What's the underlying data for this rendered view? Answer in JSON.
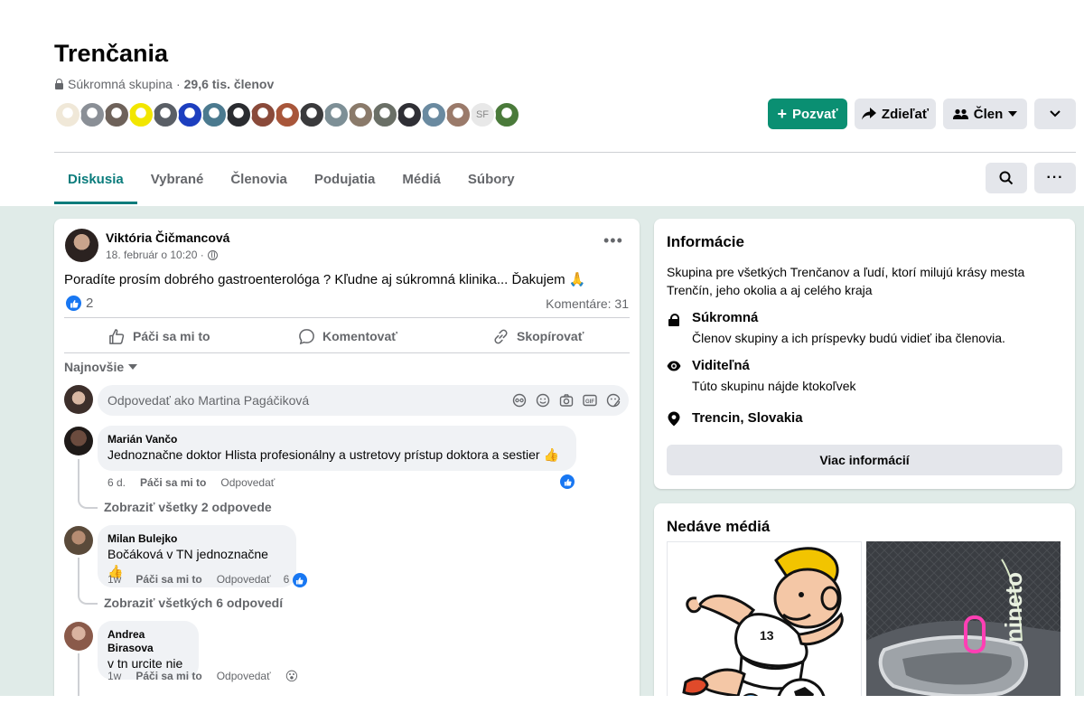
{
  "header": {
    "title": "Trenčania",
    "privacy": "Súkromná skupina",
    "separator": " · ",
    "members": "29,6 tis. členov",
    "avatar_colors": [
      "#f0e8d8",
      "#8a8f96",
      "#6e625a",
      "#f2e600",
      "#5a5f66",
      "#1d3fbf",
      "#4b7a8f",
      "#2a2c30",
      "#8a4a3a",
      "#a8563a",
      "#3a3a3c",
      "#7d8f96",
      "#8a7a6a",
      "#6a6f66",
      "#2f2f35",
      "#6a8aa0",
      "#9a7a6a",
      "#e8e8e8",
      "#4a7a3a"
    ],
    "avatar_label_gf": "SF",
    "buttons": {
      "invite": "Pozvať",
      "share": "Zdieľať",
      "member": "Člen"
    }
  },
  "tabs": [
    {
      "label": "Diskusia",
      "active": true
    },
    {
      "label": "Vybrané",
      "active": false
    },
    {
      "label": "Členovia",
      "active": false
    },
    {
      "label": "Podujatia",
      "active": false
    },
    {
      "label": "Médiá",
      "active": false
    },
    {
      "label": "Súbory",
      "active": false
    }
  ],
  "post": {
    "author": "Viktória Čičmancová",
    "time": "18. február o 10:20 ·",
    "text": "Poradíte prosím dobrého gastroenterológa ? Kľudne aj súkromná klinika... Ďakujem 🙏",
    "reactions": "2",
    "comments": "Komentáre: 31",
    "actions": {
      "like": "Páči sa mi to",
      "comment": "Komentovať",
      "copy": "Skopírovať"
    },
    "sort": "Najnovšie",
    "reply_placeholder": "Odpovedať ako Martina Pagáčiková"
  },
  "comments": [
    {
      "name": "Marián Vančo",
      "text": "Jednoznačne doktor Hlista profesionálny a ustretovy prístup doktora a sestier 👍",
      "time": "6 d.",
      "like": "Páči sa mi to",
      "reply": "Odpovedať",
      "view_replies": "Zobraziť všetky 2 odpovede"
    },
    {
      "name": "Milan Bulejko",
      "text": "Bočáková v TN jednoznačne 👍",
      "time": "1w",
      "like": "Páči sa mi to",
      "reply": "Odpovedať",
      "reaction_count": "6",
      "view_replies": "Zobraziť všetkých 6 odpovedí"
    },
    {
      "name": "Andrea Birasova",
      "text": "v tn urcite nie",
      "time": "1w",
      "like": "Páči sa mi to",
      "reply": "Odpovedať",
      "reaction_emoji": "😮"
    }
  ],
  "info": {
    "title": "Informácie",
    "description": "Skupina pre všetkých Trenčanov a ľudí, ktorí milujú krásy mesta Trenčín, jeho okolia a aj celého kraja",
    "private_title": "Súkromná",
    "private_desc": "Členov skupiny a ich príspevky budú vidieť iba členovia.",
    "visible_title": "Viditeľná",
    "visible_desc": "Túto skupinu nájde ktokoľvek",
    "location": "Trencin, Slovakia",
    "more_button": "Viac informácií"
  },
  "media": {
    "title": "Nedáve médiá",
    "jersey_number": "13",
    "logo_text": "nineto"
  },
  "colors": {
    "accent": "#0a8f72",
    "tab_active": "#0a7c7c",
    "background": "#e0ebe8",
    "like_blue": "#1877f2"
  }
}
